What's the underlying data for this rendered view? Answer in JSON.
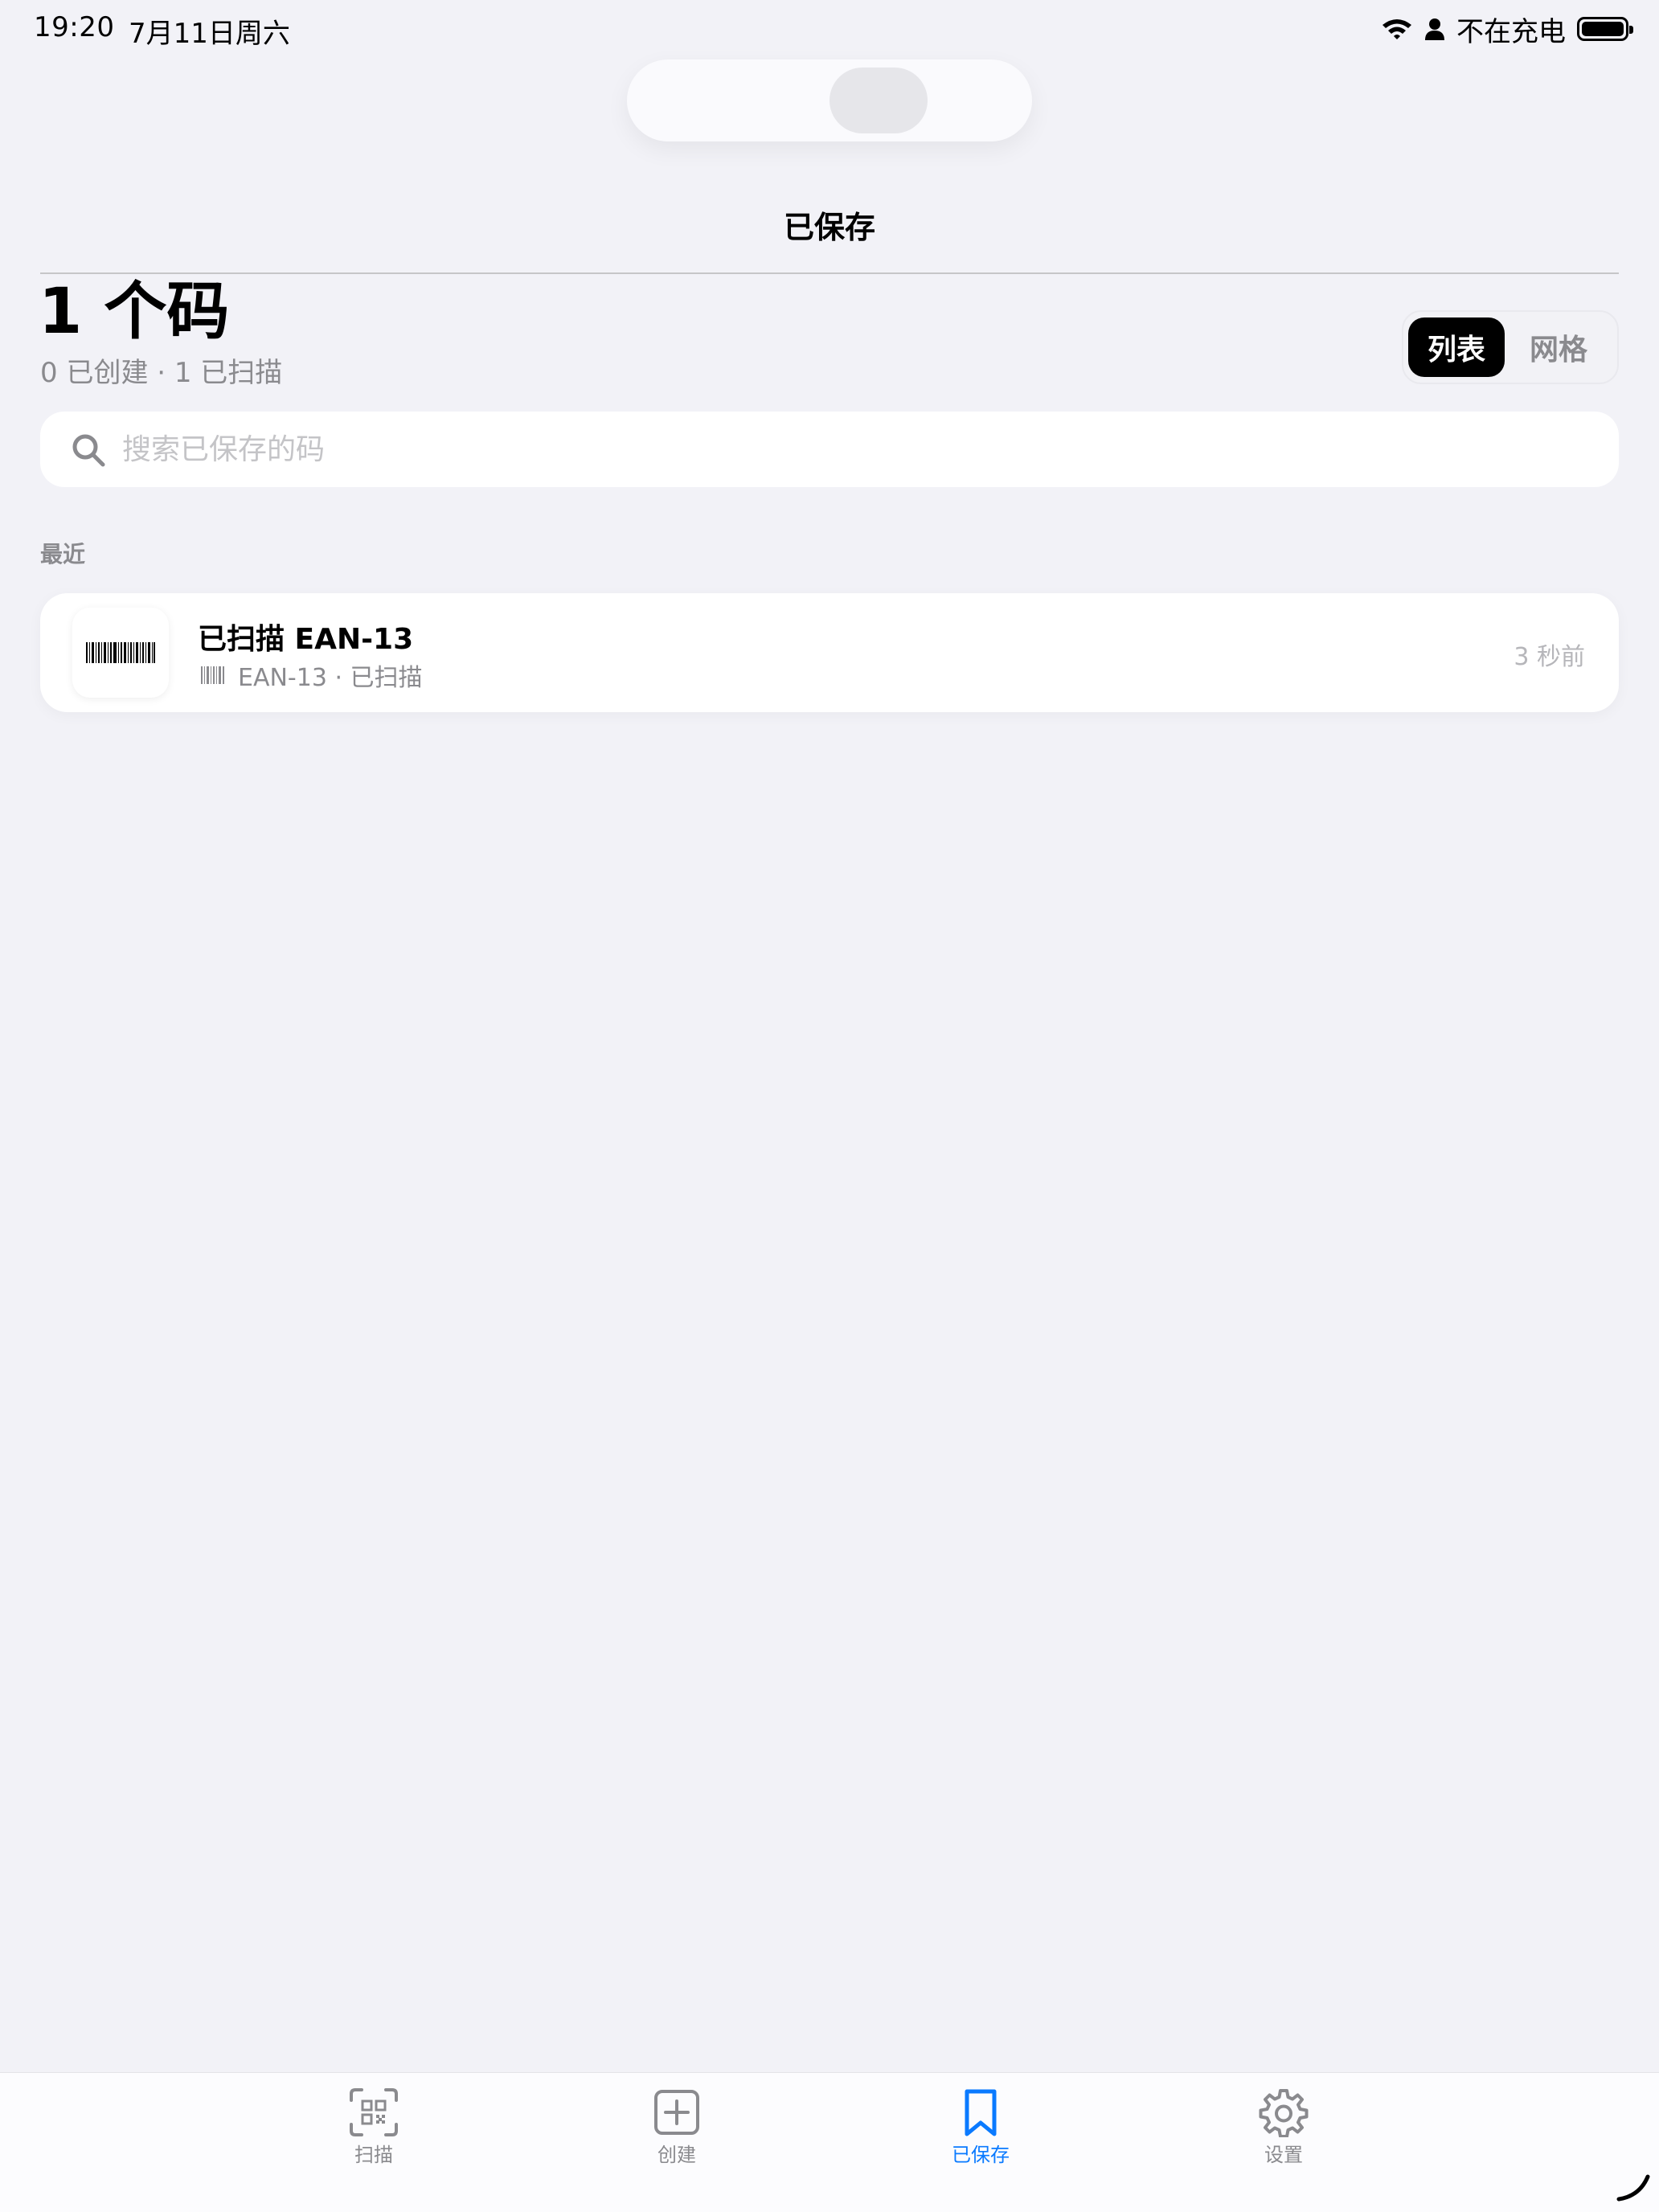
{
  "status_bar": {
    "time": "19:20",
    "date": "7月11日周六",
    "charging": "不在充电"
  },
  "nav": {
    "title": "已保存"
  },
  "header": {
    "count_title": "1 个码",
    "subtitle": "0 已创建 · 1 已扫描",
    "view_toggle": {
      "list_label": "列表",
      "grid_label": "网格",
      "selected": "列表"
    }
  },
  "search": {
    "placeholder": "搜索已保存的码",
    "value": ""
  },
  "section": {
    "label": "最近"
  },
  "items": [
    {
      "title": "已扫描 EAN-13",
      "meta": "EAN-13 · 已扫描",
      "time": "3 秒前",
      "icon": "barcode-icon"
    }
  ],
  "tabs": [
    {
      "label": "扫描",
      "icon": "qr-scan-icon",
      "active": false
    },
    {
      "label": "创建",
      "icon": "plus-square-icon",
      "active": false
    },
    {
      "label": "已保存",
      "icon": "bookmark-icon",
      "active": true
    },
    {
      "label": "设置",
      "icon": "gear-icon",
      "active": false
    }
  ],
  "colors": {
    "background": "#f2f2f7",
    "accent": "#0a7aff",
    "secondary_text": "#8a8a8e"
  }
}
